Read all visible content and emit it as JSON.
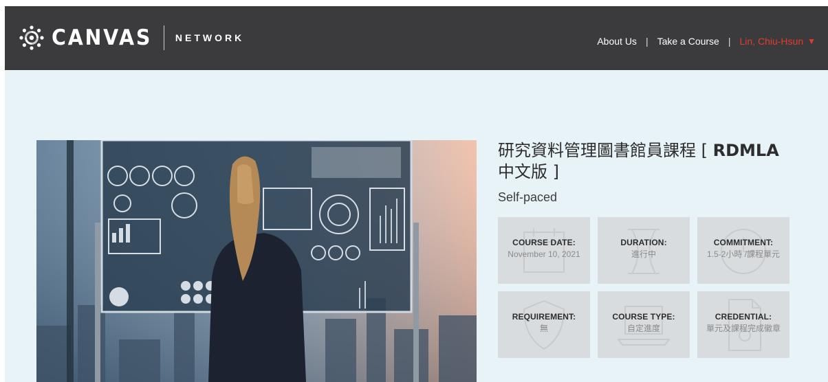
{
  "header": {
    "brand_name": "CANVAS",
    "brand_sub": "NETWORK",
    "nav": {
      "about": "About Us",
      "separator": "|",
      "take_course": "Take a Course",
      "user": "Lin, Chiu-Hsun"
    },
    "colors": {
      "bar": "#3b3b3d",
      "user": "#e53b2c"
    }
  },
  "course": {
    "title_prefix": "研究資料管理圖書館員課程 [ ",
    "title_bold": "RDMLA",
    "title_suffix": "中文版 ]",
    "pace": "Self-paced",
    "cards": [
      {
        "label": "COURSE DATE:",
        "value": "November 10, 2021"
      },
      {
        "label": "DURATION:",
        "value": "進行中"
      },
      {
        "label": "COMMITMENT:",
        "value": "1.5-2小時 /課程單元"
      },
      {
        "label": "REQUIREMENT:",
        "value": "無"
      },
      {
        "label": "COURSE TYPE:",
        "value": "自定進度"
      },
      {
        "label": "CREDENTIAL:",
        "value": "單元及課程完成徽章"
      }
    ]
  },
  "icons": [
    "canvas-logo-icon",
    "caret-down-icon"
  ],
  "page_bg": "#e8f3f8"
}
